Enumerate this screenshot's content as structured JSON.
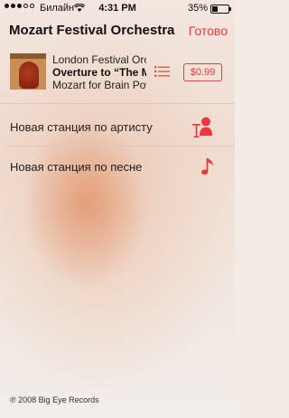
{
  "status_bar": {
    "carrier": "Билайн",
    "time": "4:31 PM",
    "battery_percent_label": "35%",
    "battery_level": 0.35
  },
  "header": {
    "title": "Mozart Festival Orchestra",
    "done_label": "Готово"
  },
  "track": {
    "line1": "London Festival Orchestra",
    "line2": "Overture to “The Marriage of Figaro”",
    "line3": "Mozart for Brain Power",
    "price": "$0.99"
  },
  "stations": [
    {
      "label": "Новая станция по артисту",
      "icon": "microphone-person-icon"
    },
    {
      "label": "Новая станция по песне",
      "icon": "music-note-icon"
    }
  ],
  "footer": {
    "copyright": "℗ 2008 Big Eye Records"
  },
  "colors": {
    "accent": "#e8383d"
  }
}
